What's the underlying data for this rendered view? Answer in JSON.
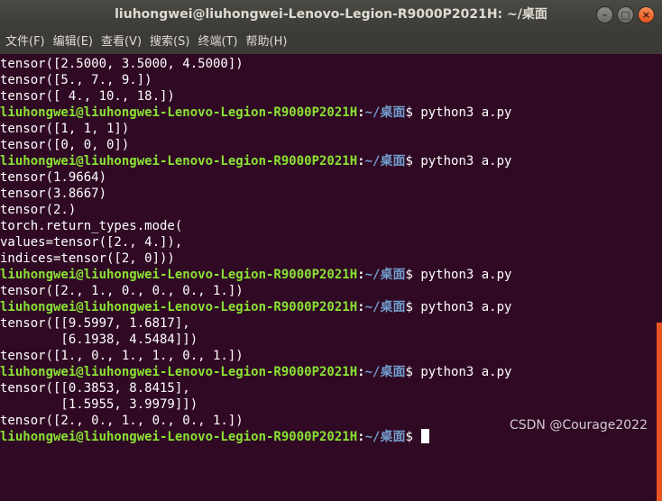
{
  "window": {
    "title": "liuhongwei@liuhongwei-Lenovo-Legion-R9000P2021H: ~/桌面",
    "buttons": {
      "minimize": "–",
      "maximize": "□",
      "close": "×"
    }
  },
  "menu": [
    "文件(F)",
    "编辑(E)",
    "查看(V)",
    "搜索(S)",
    "终端(T)",
    "帮助(H)"
  ],
  "prompt": {
    "user_host": "liuhongwei@liuhongwei-Lenovo-Legion-R9000P2021H",
    "sep": ":",
    "path": "~/桌面",
    "dollar": "$"
  },
  "lines": [
    {
      "type": "out",
      "text": "tensor([2.5000, 3.5000, 4.5000])"
    },
    {
      "type": "out",
      "text": "tensor([5., 7., 9.])"
    },
    {
      "type": "out",
      "text": "tensor([ 4., 10., 18.])"
    },
    {
      "type": "prompt",
      "cmd": " python3 a.py"
    },
    {
      "type": "out",
      "text": "tensor([1, 1, 1])"
    },
    {
      "type": "out",
      "text": "tensor([0, 0, 0])"
    },
    {
      "type": "prompt",
      "cmd": " python3 a.py"
    },
    {
      "type": "out",
      "text": "tensor(1.9664)"
    },
    {
      "type": "out",
      "text": "tensor(3.8667)"
    },
    {
      "type": "out",
      "text": "tensor(2.)"
    },
    {
      "type": "out",
      "text": "torch.return_types.mode("
    },
    {
      "type": "out",
      "text": "values=tensor([2., 4.]),"
    },
    {
      "type": "out",
      "text": "indices=tensor([2, 0]))"
    },
    {
      "type": "prompt",
      "cmd": " python3 a.py"
    },
    {
      "type": "out",
      "text": "tensor([2., 1., 0., 0., 0., 1.])"
    },
    {
      "type": "prompt",
      "cmd": " python3 a.py"
    },
    {
      "type": "out",
      "text": "tensor([[9.5997, 1.6817],"
    },
    {
      "type": "out",
      "text": "        [6.1938, 4.5484]])"
    },
    {
      "type": "out",
      "text": "tensor([1., 0., 1., 1., 0., 1.])"
    },
    {
      "type": "prompt",
      "cmd": " python3 a.py"
    },
    {
      "type": "out",
      "text": "tensor([[0.3853, 8.8415],"
    },
    {
      "type": "out",
      "text": "        [1.5955, 3.9979]])"
    },
    {
      "type": "out",
      "text": "tensor([2., 0., 1., 0., 0., 1.])"
    },
    {
      "type": "prompt",
      "cmd": " ",
      "cursor": true
    }
  ],
  "watermark": "CSDN @Courage2022"
}
